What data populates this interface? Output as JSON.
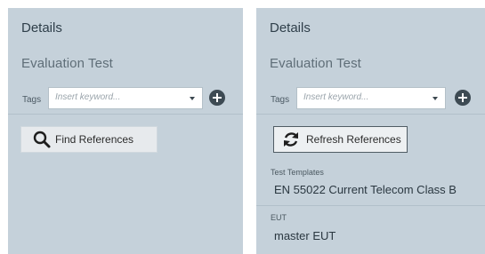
{
  "left_panel": {
    "title": "Details",
    "subtitle": "Evaluation Test",
    "tags_label": "Tags",
    "tags_placeholder": "Insert keyword...",
    "find_button_label": "Find References"
  },
  "right_panel": {
    "title": "Details",
    "subtitle": "Evaluation Test",
    "tags_label": "Tags",
    "tags_placeholder": "Insert keyword...",
    "refresh_button_label": "Refresh References",
    "fields": [
      {
        "label": "Test Templates",
        "value": "EN 55022 Current Telecom Class B"
      },
      {
        "label": "EUT",
        "value": "master EUT"
      }
    ]
  },
  "icons": {
    "add": "plus-circle-icon",
    "dropdown": "chevron-down-icon",
    "search": "magnifier-icon",
    "refresh": "refresh-icon"
  }
}
